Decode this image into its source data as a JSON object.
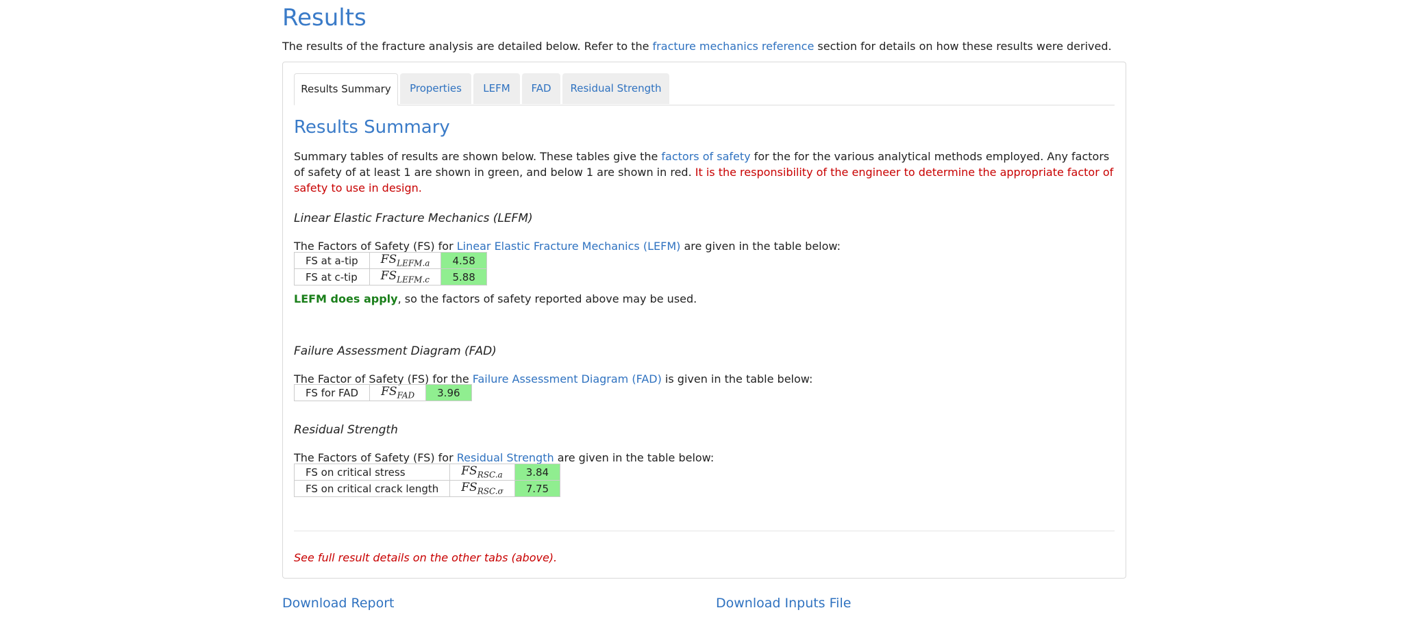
{
  "page": {
    "title": "Results",
    "intro_prefix": "The results of the fracture analysis are detailed below. Refer to the ",
    "intro_link": "fracture mechanics reference",
    "intro_suffix": " section for details on how these results were derived."
  },
  "tabs": [
    {
      "label": "Results Summary",
      "active": true
    },
    {
      "label": "Properties",
      "active": false
    },
    {
      "label": "LEFM",
      "active": false
    },
    {
      "label": "FAD",
      "active": false
    },
    {
      "label": "Residual Strength",
      "active": false
    }
  ],
  "summary": {
    "heading": "Results Summary",
    "p1_a": "Summary tables of results are shown below. These tables give the ",
    "p1_link": "factors of safety",
    "p1_b": " for the for the various analytical methods employed. Any factors of safety of at least 1 are shown in green, and below 1 are shown in red. ",
    "p1_red": "It is the responsibility of the engineer to determine the appropriate factor of safety to use in design."
  },
  "lefm": {
    "heading": "Linear Elastic Fracture Mechanics (LEFM)",
    "p_a": "The Factors of Safety (FS) for ",
    "p_link": "Linear Elastic Fracture Mechanics (LEFM)",
    "p_b": " are given in the table below:",
    "rows": [
      {
        "label": "FS at a-tip",
        "sym": "FS",
        "sub": "LEFM.a",
        "value": "4.58"
      },
      {
        "label": "FS at c-tip",
        "sym": "FS",
        "sub": "LEFM.c",
        "value": "5.88"
      }
    ],
    "note_strong": "LEFM does apply",
    "note_rest": ", so the factors of safety reported above may be used."
  },
  "fad": {
    "heading": "Failure Assessment Diagram (FAD)",
    "p_a": "The Factor of Safety (FS) for the ",
    "p_link": "Failure Assessment Diagram (FAD)",
    "p_b": " is given in the table below:",
    "rows": [
      {
        "label": "FS for FAD",
        "sym": "FS",
        "sub": "FAD",
        "value": "3.96"
      }
    ]
  },
  "residual": {
    "heading": "Residual Strength",
    "p_a": "The Factors of Safety (FS) for ",
    "p_link": "Residual Strength",
    "p_b": " are given in the table below:",
    "rows": [
      {
        "label": "FS on critical stress",
        "sym": "FS",
        "sub": "RSC.a",
        "value": "3.84"
      },
      {
        "label": "FS on critical crack length",
        "sym": "FS",
        "sub": "RSC.σ",
        "value": "7.75"
      }
    ]
  },
  "footnote": "See full result details on the other tabs (above).",
  "downloads": {
    "report": "Download Report",
    "inputs": "Download Inputs File"
  },
  "colors": {
    "accent": "#3a7bc8",
    "link": "#2f72c0",
    "pass": "#90ee90",
    "warn": "#c80000"
  }
}
